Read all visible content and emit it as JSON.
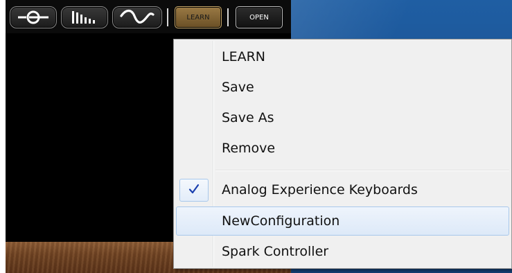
{
  "toolbar": {
    "buttons": [
      {
        "icon": "connector-icon"
      },
      {
        "icon": "bars-icon"
      },
      {
        "icon": "waveform-icon"
      }
    ],
    "learn_label": "LEARN",
    "open_label": "OPEN"
  },
  "menu": {
    "items": [
      {
        "label": "LEARN",
        "checked": false,
        "highlighted": false
      },
      {
        "label": "Save",
        "checked": false,
        "highlighted": false
      },
      {
        "label": "Save As",
        "checked": false,
        "highlighted": false
      },
      {
        "label": "Remove",
        "checked": false,
        "highlighted": false
      },
      {
        "label": "Analog Experience Keyboards",
        "checked": true,
        "highlighted": false
      },
      {
        "label": "NewConfiguration",
        "checked": false,
        "highlighted": true
      },
      {
        "label": "Spark Controller",
        "checked": false,
        "highlighted": false
      }
    ]
  },
  "colors": {
    "menu_background": "#f0f0f0",
    "menu_highlight_border": "#a8c8eb",
    "checkmark": "#1a3fae",
    "learn_button": "#8a6b3a",
    "desktop_blue": "#1a4f8e"
  }
}
